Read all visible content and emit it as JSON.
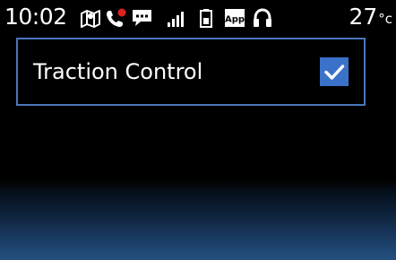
{
  "status_bar": {
    "time": "10:02",
    "temperature": "27",
    "temperature_unit": "c",
    "icons": [
      "map-icon",
      "missed-call-icon",
      "message-icon",
      "signal-icon",
      "battery-icon",
      "app-icon",
      "headset-icon"
    ],
    "app_icon_label": "App"
  },
  "settings": {
    "items": [
      {
        "label": "Traction Control",
        "checked": true
      }
    ]
  },
  "colors": {
    "background": "#000000",
    "accent": "#3b72c9",
    "selection_border": "#4a76ba",
    "missed_call_dot": "#e02020"
  }
}
